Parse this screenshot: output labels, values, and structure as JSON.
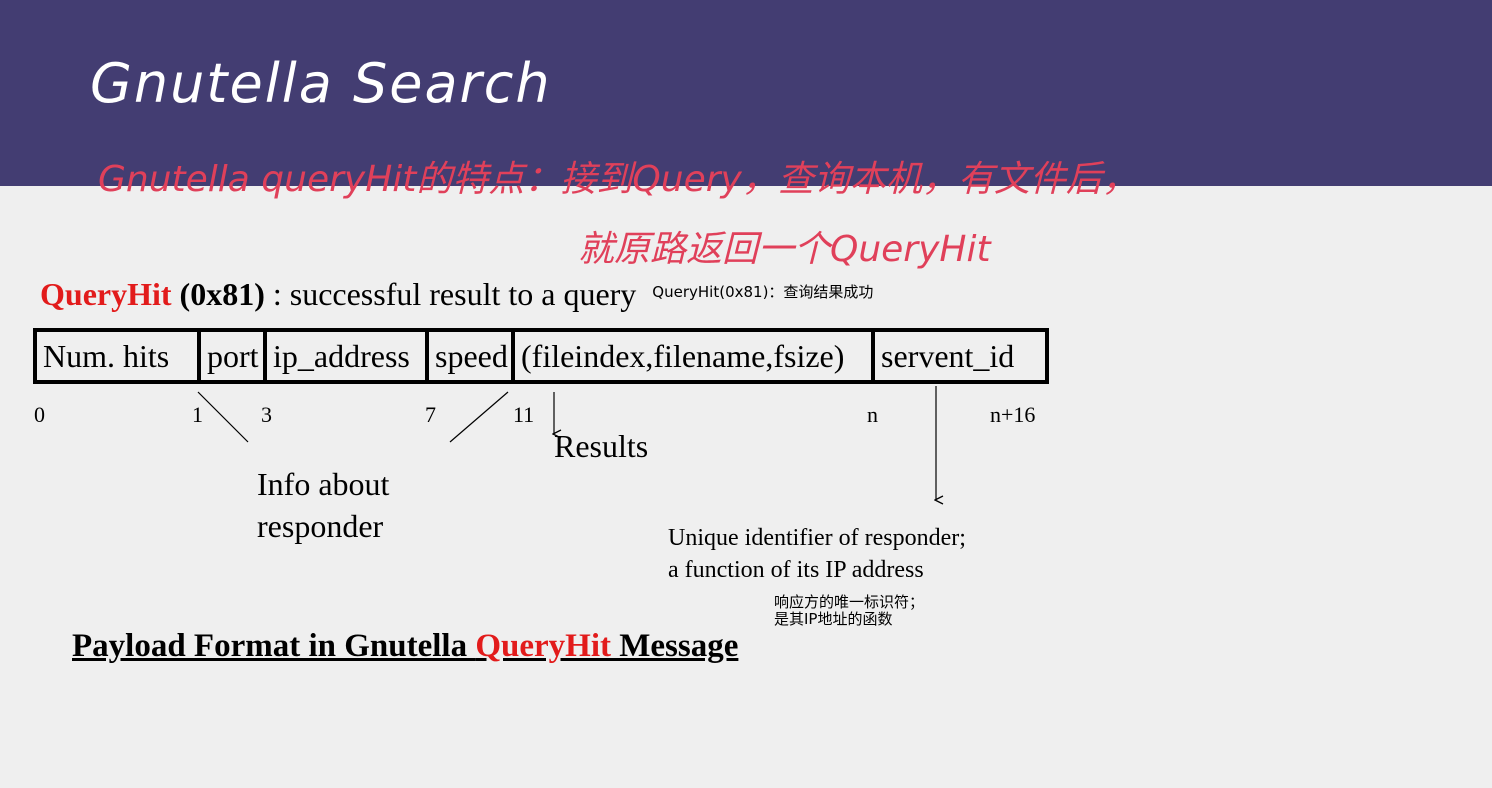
{
  "slide": {
    "title": "Gnutella Search"
  },
  "handwriting": {
    "line1": "Gnutella queryHit的特点：接到Query，查询本机，有文件后，",
    "line2": "就原路返回一个QueryHit"
  },
  "heading": {
    "name": "QueryHit",
    "code": "(0x81)",
    "rest": " : successful result to a query",
    "zh_note": "QueryHit(0x81)：查询结果成功"
  },
  "fields": [
    "Num. hits",
    "port",
    "ip_address",
    "speed",
    "(fileindex,filename,fsize)",
    "servent_id"
  ],
  "offsets": [
    "0",
    "1",
    "3",
    "7",
    "11",
    "n",
    "n+16"
  ],
  "annotations": {
    "results": "Results",
    "info_line1": "Info about",
    "info_line2": "responder",
    "unique_line1": "Unique identifier of responder;",
    "unique_line2": "a function of its IP address",
    "unique_zh_line1": "响应方的唯一标识符；",
    "unique_zh_line2": "是其IP地址的函数"
  },
  "caption": {
    "before": "Payload Format in Gnutella ",
    "highlight": "QueryHit",
    "after": " Message"
  },
  "colors": {
    "title_bar": "#433d72",
    "highlight_red": "#e21b1b",
    "handwriting_pink": "#e0405a"
  }
}
